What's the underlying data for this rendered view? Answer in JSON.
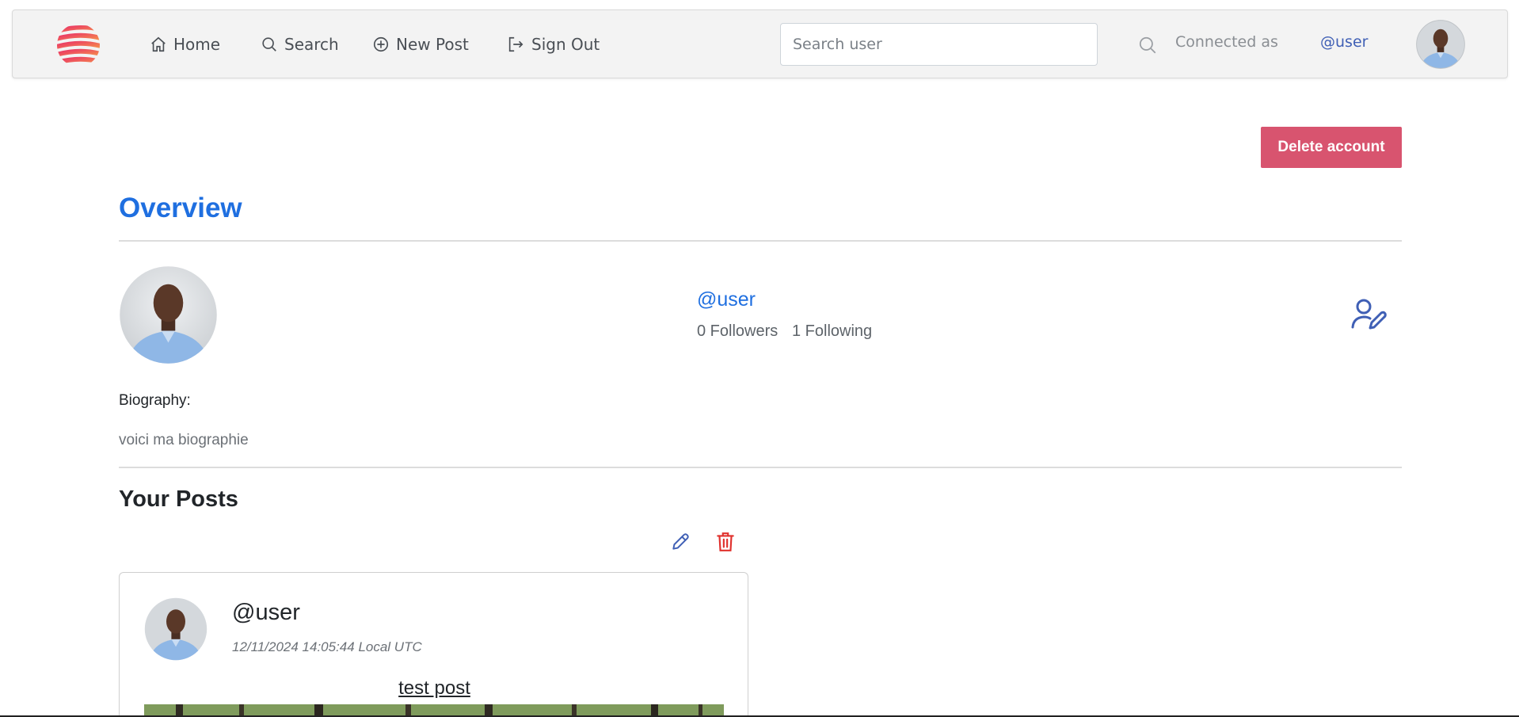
{
  "navbar": {
    "links": {
      "home": "Home",
      "search": "Search",
      "new_post": "New Post",
      "sign_out": "Sign Out"
    },
    "search_placeholder": "Search user",
    "connected_label": "Connected as",
    "username": "@user"
  },
  "main": {
    "delete_account": "Delete account",
    "overview_title": "Overview",
    "profile": {
      "username": "@user",
      "followers": "0 Followers",
      "following": "1 Following"
    },
    "biography_label": "Biography:",
    "biography_text": "voici ma biographie",
    "posts_title": "Your Posts",
    "post": {
      "username": "@user",
      "date": "12/11/2024 14:05:44 Local UTC",
      "title": "test post"
    }
  },
  "colors": {
    "accent": "#1f6fe0",
    "danger_button": "#d8546f",
    "trash_icon": "#e0312d",
    "nav_user": "#3f5fb5"
  },
  "icons": [
    "logo-icon",
    "home-icon",
    "search-icon",
    "plus-circle-icon",
    "sign-out-icon",
    "user-edit-icon",
    "pencil-icon",
    "trash-icon"
  ]
}
